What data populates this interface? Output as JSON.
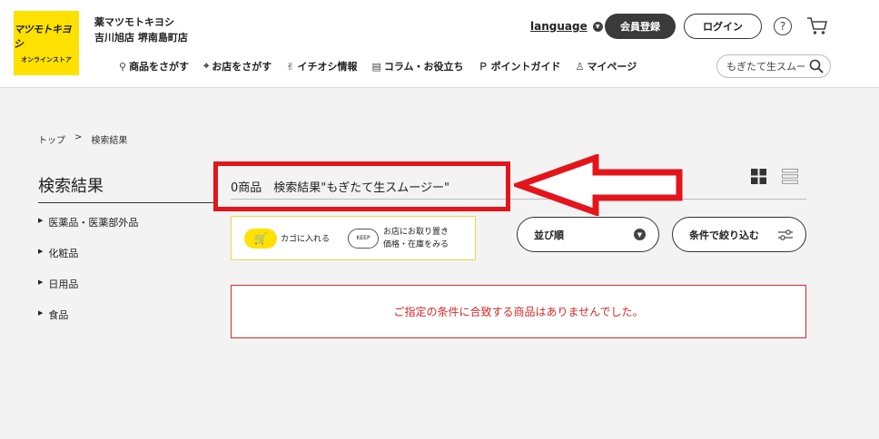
{
  "header": {
    "logo_line1": "マツモトキヨシ",
    "logo_line2": "オンラインストア",
    "store_line1": "薬マツモトキヨシ",
    "store_line2": "吉川旭店 堺南島町店",
    "language_label": "language",
    "register_label": "会員登録",
    "login_label": "ログイン",
    "help_glyph": "?",
    "search_value": "もぎたて生スムー"
  },
  "nav": [
    {
      "icon": "search-icon",
      "glyph": "⚲",
      "label": "商品をさがす"
    },
    {
      "icon": "pin-icon",
      "glyph": "⌖",
      "label": "お店をさがす"
    },
    {
      "icon": "thumbs-up-icon",
      "glyph": "✌",
      "label": "イチオシ情報"
    },
    {
      "icon": "document-icon",
      "glyph": "▤",
      "label": "コラム・お役立ち"
    },
    {
      "icon": "point-icon",
      "glyph": "Ｐ",
      "label": "ポイントガイド"
    },
    {
      "icon": "person-icon",
      "glyph": "♙",
      "label": "マイページ"
    }
  ],
  "breadcrumb": {
    "home": "トップ",
    "sep": ">",
    "current": "検索結果"
  },
  "sidebar": {
    "title": "検索結果",
    "items": [
      {
        "label": "医薬品・医薬部外品"
      },
      {
        "label": "化粧品"
      },
      {
        "label": "日用品"
      },
      {
        "label": "食品"
      }
    ]
  },
  "results": {
    "summary": "0商品　検索結果\"もぎたて生スムージー\"",
    "legend_cart": "カゴに入れる",
    "legend_keep_badge": "KEEP",
    "legend_store_line1": "お店にお取り置き",
    "legend_store_line2": "価格・在庫をみる",
    "sort_label": "並び順",
    "filter_label": "条件で絞り込む",
    "no_result": "ご指定の条件に合致する商品はありませんでした。"
  },
  "colors": {
    "brand_yellow": "#ffe100",
    "highlight_red": "#e3151b",
    "error_red": "#d52a2a"
  }
}
